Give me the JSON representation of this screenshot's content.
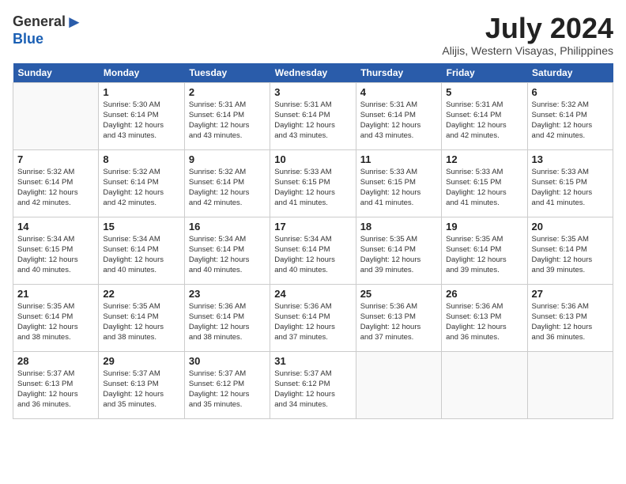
{
  "header": {
    "logo_line1": "General",
    "logo_line2": "Blue",
    "month_title": "July 2024",
    "location": "Alijis, Western Visayas, Philippines"
  },
  "days_of_week": [
    "Sunday",
    "Monday",
    "Tuesday",
    "Wednesday",
    "Thursday",
    "Friday",
    "Saturday"
  ],
  "weeks": [
    [
      {
        "day": "",
        "info": ""
      },
      {
        "day": "1",
        "info": "Sunrise: 5:30 AM\nSunset: 6:14 PM\nDaylight: 12 hours\nand 43 minutes."
      },
      {
        "day": "2",
        "info": "Sunrise: 5:31 AM\nSunset: 6:14 PM\nDaylight: 12 hours\nand 43 minutes."
      },
      {
        "day": "3",
        "info": "Sunrise: 5:31 AM\nSunset: 6:14 PM\nDaylight: 12 hours\nand 43 minutes."
      },
      {
        "day": "4",
        "info": "Sunrise: 5:31 AM\nSunset: 6:14 PM\nDaylight: 12 hours\nand 43 minutes."
      },
      {
        "day": "5",
        "info": "Sunrise: 5:31 AM\nSunset: 6:14 PM\nDaylight: 12 hours\nand 42 minutes."
      },
      {
        "day": "6",
        "info": "Sunrise: 5:32 AM\nSunset: 6:14 PM\nDaylight: 12 hours\nand 42 minutes."
      }
    ],
    [
      {
        "day": "7",
        "info": "Sunrise: 5:32 AM\nSunset: 6:14 PM\nDaylight: 12 hours\nand 42 minutes."
      },
      {
        "day": "8",
        "info": "Sunrise: 5:32 AM\nSunset: 6:14 PM\nDaylight: 12 hours\nand 42 minutes."
      },
      {
        "day": "9",
        "info": "Sunrise: 5:32 AM\nSunset: 6:14 PM\nDaylight: 12 hours\nand 42 minutes."
      },
      {
        "day": "10",
        "info": "Sunrise: 5:33 AM\nSunset: 6:15 PM\nDaylight: 12 hours\nand 41 minutes."
      },
      {
        "day": "11",
        "info": "Sunrise: 5:33 AM\nSunset: 6:15 PM\nDaylight: 12 hours\nand 41 minutes."
      },
      {
        "day": "12",
        "info": "Sunrise: 5:33 AM\nSunset: 6:15 PM\nDaylight: 12 hours\nand 41 minutes."
      },
      {
        "day": "13",
        "info": "Sunrise: 5:33 AM\nSunset: 6:15 PM\nDaylight: 12 hours\nand 41 minutes."
      }
    ],
    [
      {
        "day": "14",
        "info": "Sunrise: 5:34 AM\nSunset: 6:15 PM\nDaylight: 12 hours\nand 40 minutes."
      },
      {
        "day": "15",
        "info": "Sunrise: 5:34 AM\nSunset: 6:14 PM\nDaylight: 12 hours\nand 40 minutes."
      },
      {
        "day": "16",
        "info": "Sunrise: 5:34 AM\nSunset: 6:14 PM\nDaylight: 12 hours\nand 40 minutes."
      },
      {
        "day": "17",
        "info": "Sunrise: 5:34 AM\nSunset: 6:14 PM\nDaylight: 12 hours\nand 40 minutes."
      },
      {
        "day": "18",
        "info": "Sunrise: 5:35 AM\nSunset: 6:14 PM\nDaylight: 12 hours\nand 39 minutes."
      },
      {
        "day": "19",
        "info": "Sunrise: 5:35 AM\nSunset: 6:14 PM\nDaylight: 12 hours\nand 39 minutes."
      },
      {
        "day": "20",
        "info": "Sunrise: 5:35 AM\nSunset: 6:14 PM\nDaylight: 12 hours\nand 39 minutes."
      }
    ],
    [
      {
        "day": "21",
        "info": "Sunrise: 5:35 AM\nSunset: 6:14 PM\nDaylight: 12 hours\nand 38 minutes."
      },
      {
        "day": "22",
        "info": "Sunrise: 5:35 AM\nSunset: 6:14 PM\nDaylight: 12 hours\nand 38 minutes."
      },
      {
        "day": "23",
        "info": "Sunrise: 5:36 AM\nSunset: 6:14 PM\nDaylight: 12 hours\nand 38 minutes."
      },
      {
        "day": "24",
        "info": "Sunrise: 5:36 AM\nSunset: 6:14 PM\nDaylight: 12 hours\nand 37 minutes."
      },
      {
        "day": "25",
        "info": "Sunrise: 5:36 AM\nSunset: 6:13 PM\nDaylight: 12 hours\nand 37 minutes."
      },
      {
        "day": "26",
        "info": "Sunrise: 5:36 AM\nSunset: 6:13 PM\nDaylight: 12 hours\nand 36 minutes."
      },
      {
        "day": "27",
        "info": "Sunrise: 5:36 AM\nSunset: 6:13 PM\nDaylight: 12 hours\nand 36 minutes."
      }
    ],
    [
      {
        "day": "28",
        "info": "Sunrise: 5:37 AM\nSunset: 6:13 PM\nDaylight: 12 hours\nand 36 minutes."
      },
      {
        "day": "29",
        "info": "Sunrise: 5:37 AM\nSunset: 6:13 PM\nDaylight: 12 hours\nand 35 minutes."
      },
      {
        "day": "30",
        "info": "Sunrise: 5:37 AM\nSunset: 6:12 PM\nDaylight: 12 hours\nand 35 minutes."
      },
      {
        "day": "31",
        "info": "Sunrise: 5:37 AM\nSunset: 6:12 PM\nDaylight: 12 hours\nand 34 minutes."
      },
      {
        "day": "",
        "info": ""
      },
      {
        "day": "",
        "info": ""
      },
      {
        "day": "",
        "info": ""
      }
    ]
  ]
}
